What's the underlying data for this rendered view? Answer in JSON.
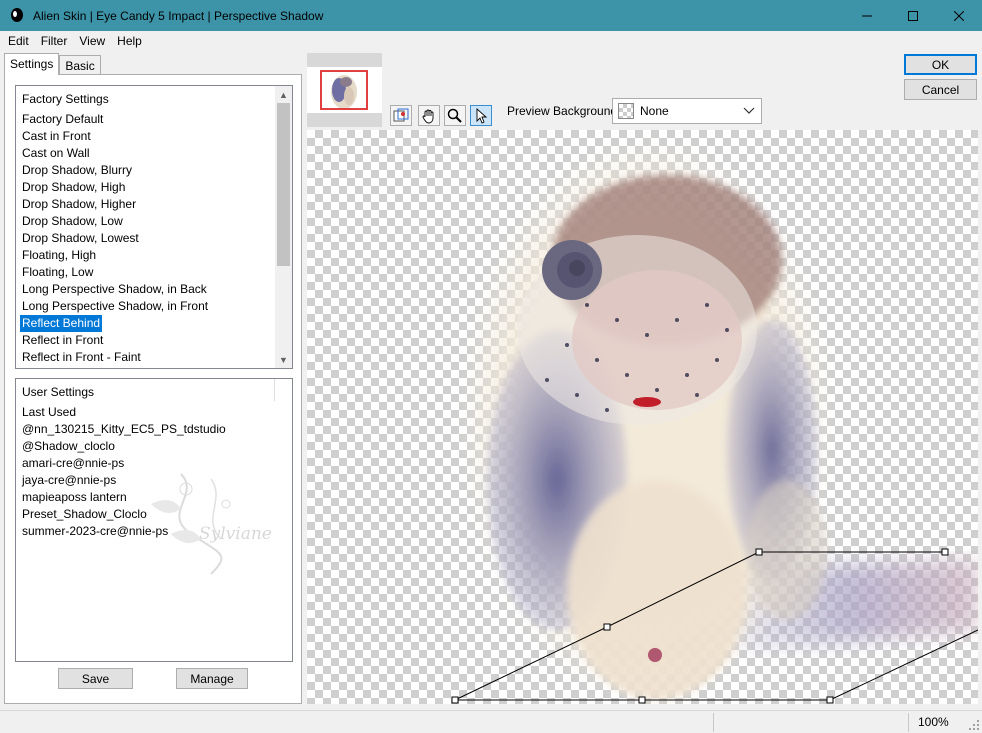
{
  "window": {
    "title": "Alien Skin | Eye Candy 5 Impact | Perspective Shadow"
  },
  "menu": [
    "Edit",
    "Filter",
    "View",
    "Help"
  ],
  "tabs": [
    {
      "label": "Settings",
      "active": true
    },
    {
      "label": "Basic",
      "active": false
    }
  ],
  "factory_settings": {
    "header": "Factory Settings",
    "items": [
      "Factory Default",
      "Cast in Front",
      "Cast on Wall",
      "Drop Shadow, Blurry",
      "Drop Shadow, High",
      "Drop Shadow, Higher",
      "Drop Shadow, Low",
      "Drop Shadow, Lowest",
      "Floating, High",
      "Floating, Low",
      "Long Perspective Shadow, in Back",
      "Long Perspective Shadow, in Front",
      "Reflect Behind",
      "Reflect in Front",
      "Reflect in Front - Faint"
    ],
    "selected": "Reflect Behind"
  },
  "user_settings": {
    "header": "User Settings",
    "items": [
      "Last Used",
      "@nn_130215_Kitty_EC5_PS_tdstudio",
      "@Shadow_cloclo",
      "amari-cre@nnie-ps",
      "jaya-cre@nnie-ps",
      "mapieaposs lantern",
      "Preset_Shadow_Cloclo",
      "summer-2023-cre@nnie-ps"
    ]
  },
  "buttons": {
    "save": "Save",
    "manage": "Manage",
    "ok": "OK",
    "cancel": "Cancel"
  },
  "watermark": "Sylviane",
  "preview": {
    "background_label": "Preview Background:",
    "background_value": "None",
    "tools": [
      "navigator-icon",
      "hand-icon",
      "zoom-icon",
      "arrow-icon"
    ],
    "active_tool": "arrow-icon"
  },
  "status": {
    "zoom": "100%"
  },
  "colors": {
    "titlebar": "#3d94a9",
    "selection": "#0078d7",
    "default_button_border": "#0078d7"
  }
}
